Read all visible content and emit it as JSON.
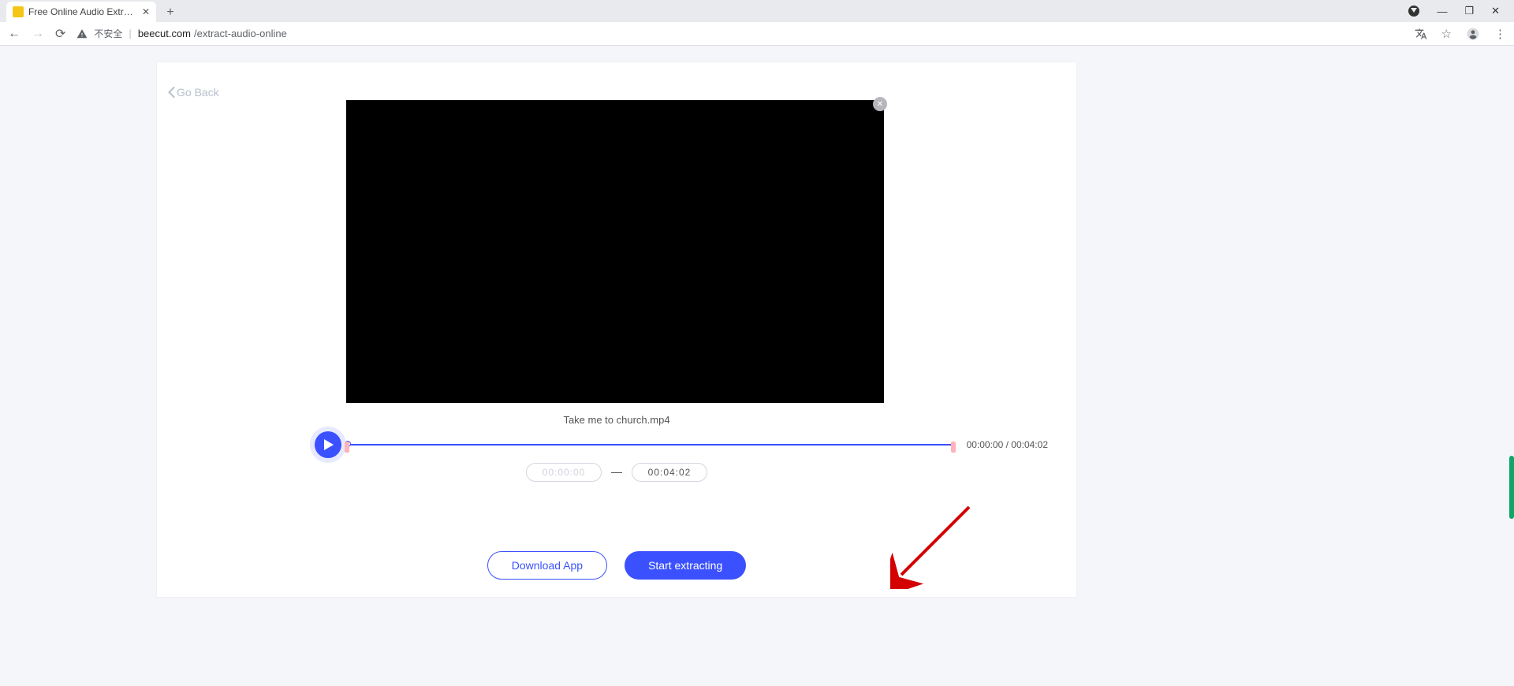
{
  "browser": {
    "tab_title": "Free Online Audio Extractor - |",
    "security_label": "不安全",
    "url_host": "beecut.com",
    "url_path": "/extract-audio-online"
  },
  "page": {
    "go_back_label": "Go Back",
    "filename": "Take me to church.mp4",
    "time_readout": "00:00:00 / 00:04:02",
    "start_time_placeholder": "00:00:00",
    "end_time_value": "00:04:02",
    "download_label": "Download App",
    "extract_label": "Start extracting"
  }
}
